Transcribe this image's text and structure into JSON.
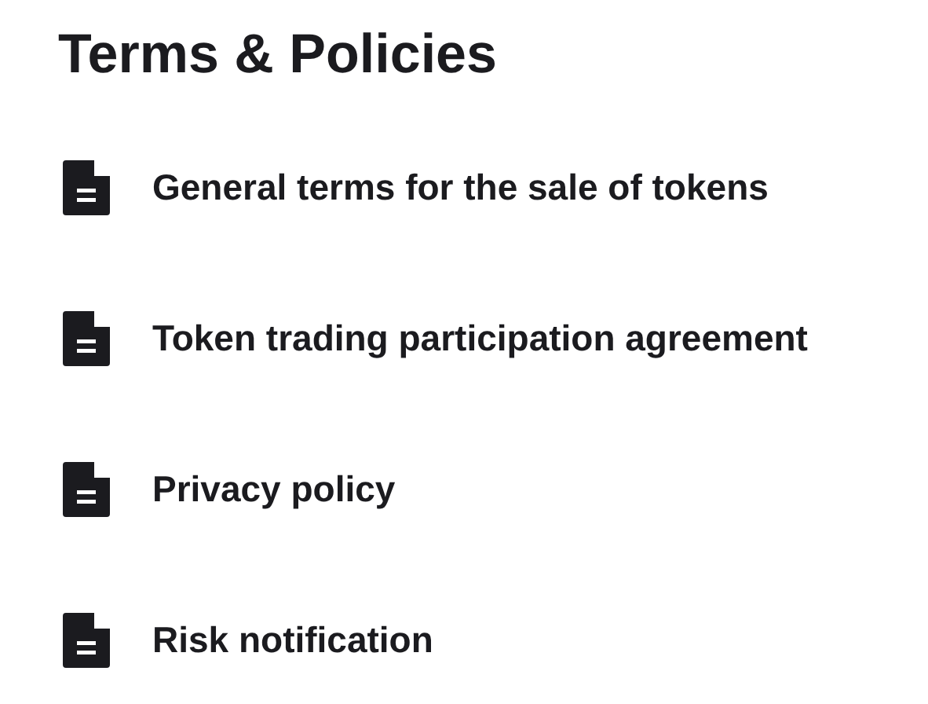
{
  "title": "Terms & Policies",
  "documents": [
    {
      "label": "General terms for the sale of tokens"
    },
    {
      "label": "Token trading participation agreement"
    },
    {
      "label": "Privacy policy"
    },
    {
      "label": "Risk notification"
    }
  ]
}
